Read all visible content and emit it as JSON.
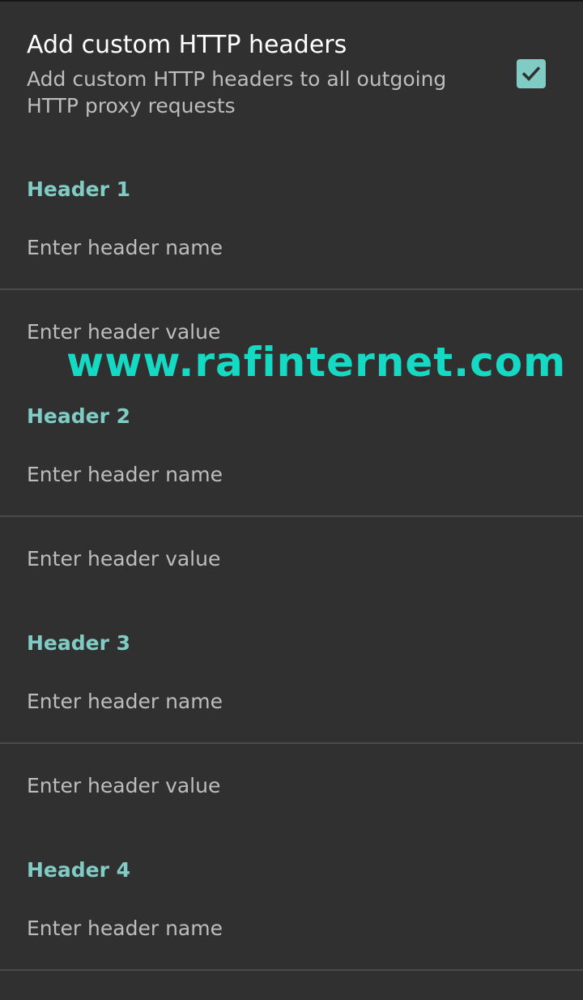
{
  "preference": {
    "title": "Add custom HTTP headers",
    "summary": "Add custom HTTP headers to all outgoing HTTP proxy requests",
    "checked": true,
    "accent_color": "#80cbc4"
  },
  "headers": [
    {
      "label": "Header 1",
      "name_placeholder": "Enter header name",
      "value_placeholder": "Enter header value"
    },
    {
      "label": "Header 2",
      "name_placeholder": "Enter header name",
      "value_placeholder": "Enter header value"
    },
    {
      "label": "Header 3",
      "name_placeholder": "Enter header name",
      "value_placeholder": "Enter header value"
    },
    {
      "label": "Header 4",
      "name_placeholder": "Enter header name"
    }
  ],
  "watermark": "www.rafinternet.com"
}
